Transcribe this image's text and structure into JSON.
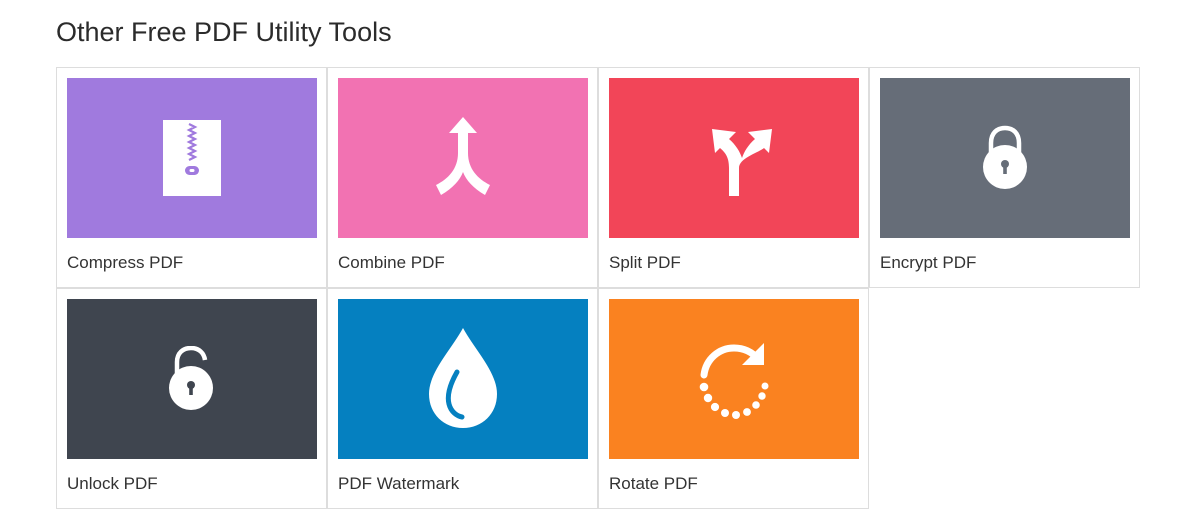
{
  "section": {
    "title": "Other Free PDF Utility Tools"
  },
  "tools": [
    {
      "label": "Compress PDF",
      "color": "#a07ade",
      "icon": "zip-file-icon"
    },
    {
      "label": "Combine PDF",
      "color": "#f272b2",
      "icon": "merge-arrow-icon"
    },
    {
      "label": "Split PDF",
      "color": "#f24558",
      "icon": "split-arrow-icon"
    },
    {
      "label": "Encrypt PDF",
      "color": "#666d78",
      "icon": "lock-icon"
    },
    {
      "label": "Unlock PDF",
      "color": "#3f454f",
      "icon": "unlock-icon"
    },
    {
      "label": "PDF Watermark",
      "color": "#0580c0",
      "icon": "water-drop-icon"
    },
    {
      "label": "Rotate PDF",
      "color": "#fa8220",
      "icon": "rotate-icon"
    }
  ]
}
